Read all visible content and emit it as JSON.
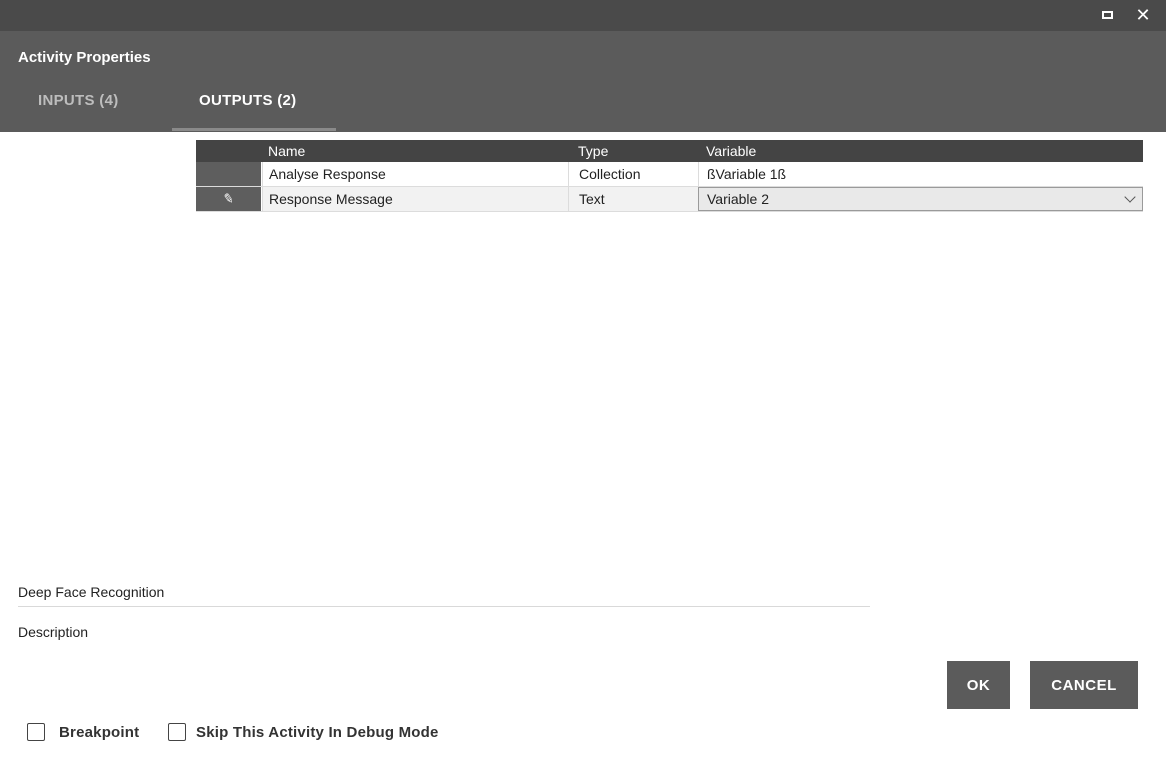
{
  "window": {
    "maximize_icon": "maximize-icon",
    "close_icon": "close-icon",
    "close_glyph": "✕"
  },
  "header": {
    "title": "Activity Properties",
    "tabs": [
      {
        "label": "INPUTS (4)",
        "active": false
      },
      {
        "label": "OUTPUTS (2)",
        "active": true
      }
    ]
  },
  "grid": {
    "columns": [
      "Name",
      "Type",
      "Variable"
    ],
    "rows": [
      {
        "name": "Analyse Response",
        "type": "Collection",
        "variable": "ßVariable 1ß",
        "selected": false
      },
      {
        "name": "Response Message",
        "type": "Text",
        "variable": "Variable 2",
        "selected": true,
        "editing_icon": "pencil-icon"
      }
    ]
  },
  "footer": {
    "activity_name": "Deep Face Recognition",
    "description": "Description",
    "ok_label": "OK",
    "cancel_label": "CANCEL",
    "breakpoint_label": "Breakpoint",
    "skip_label": "Skip This Activity In Debug Mode",
    "breakpoint_checked": false,
    "skip_checked": false
  },
  "colors": {
    "titlebar": "#4a4a4a",
    "header": "#5b5b5b",
    "grid_header": "#444444",
    "button": "#5b5b5b"
  }
}
